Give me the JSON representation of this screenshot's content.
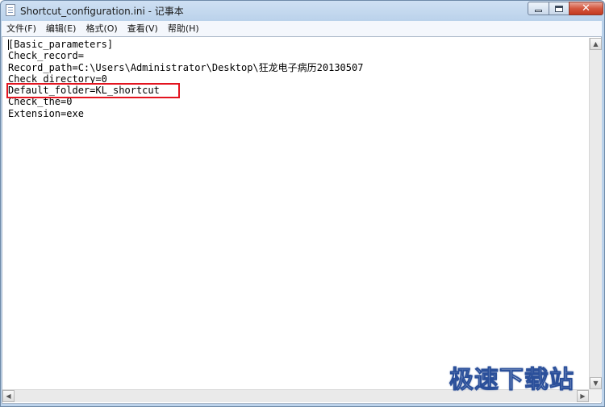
{
  "window": {
    "title": "Shortcut_configuration.ini - 记事本",
    "controls": {
      "minimize": "minimize",
      "maximize": "maximize",
      "close": "✕"
    }
  },
  "menu": [
    {
      "label": "文件(F)"
    },
    {
      "label": "编辑(E)"
    },
    {
      "label": "格式(O)"
    },
    {
      "label": "查看(V)"
    },
    {
      "label": "帮助(H)"
    }
  ],
  "editor": {
    "lines": [
      "[Basic_parameters]",
      "Check_record=",
      "Record_path=C:\\Users\\Administrator\\Desktop\\狂龙电子病历20130507",
      "Check_directory=0",
      "Default_folder=KL_shortcut",
      "Check_the=0",
      "Extension=exe"
    ],
    "highlighted_line_index": 4,
    "highlight_color": "#e3141f"
  },
  "watermark": {
    "text": "极速下载站"
  },
  "icons": {
    "app": "notepad-icon",
    "scroll_up": "arrow-up-icon",
    "scroll_down": "arrow-down-icon",
    "scroll_left": "arrow-left-icon",
    "scroll_right": "arrow-right-icon"
  }
}
